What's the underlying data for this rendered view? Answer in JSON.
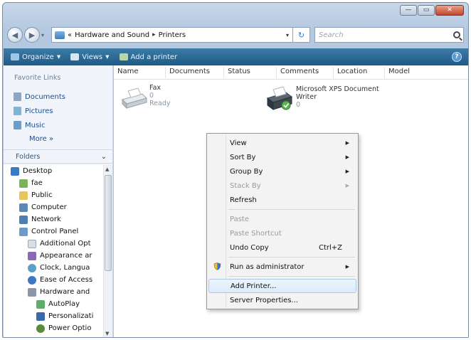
{
  "window": {
    "controls": {
      "minimize": "—",
      "maximize": "▭",
      "close": "✕"
    }
  },
  "address_bar": {
    "prefix": "«",
    "crumbs": [
      "Hardware and Sound",
      "Printers"
    ],
    "separator": "▸",
    "dropdown": "▾",
    "refresh": "↻"
  },
  "search": {
    "placeholder": "Search"
  },
  "toolbar": {
    "organize": "Organize",
    "views": "Views",
    "add_printer": "Add a printer",
    "help": "?"
  },
  "left_pane": {
    "favorite_links_title": "Favorite Links",
    "favorites": [
      "Documents",
      "Pictures",
      "Music"
    ],
    "more": "More",
    "more_arrow": "»",
    "folders_title": "Folders",
    "folders_chevron": "⌄",
    "tree": [
      "Desktop",
      "fae",
      "Public",
      "Computer",
      "Network",
      "Control Panel",
      "Additional Opt",
      "Appearance ar",
      "Clock, Langua",
      "Ease of Access",
      "Hardware and",
      "AutoPlay",
      "Personalizati",
      "Power Optio"
    ]
  },
  "columns": [
    "Name",
    "Documents",
    "Status",
    "Comments",
    "Location",
    "Model"
  ],
  "printers": [
    {
      "name": "Fax",
      "documents": "0",
      "status": "Ready"
    },
    {
      "name_line1": "Microsoft XPS Document",
      "name_line2": "Writer",
      "documents": "0"
    }
  ],
  "context_menu": {
    "items": [
      {
        "label": "View",
        "submenu": true
      },
      {
        "label": "Sort By",
        "submenu": true
      },
      {
        "label": "Group By",
        "submenu": true
      },
      {
        "label": "Stack By",
        "submenu": true,
        "disabled": true
      },
      {
        "label": "Refresh"
      },
      {
        "label": "Paste",
        "disabled": true
      },
      {
        "label": "Paste Shortcut",
        "disabled": true
      },
      {
        "label": "Undo Copy",
        "shortcut": "Ctrl+Z"
      },
      {
        "label": "Run as administrator",
        "submenu": true
      },
      {
        "label": "Add Printer...",
        "highlighted": true
      },
      {
        "label": "Server Properties..."
      }
    ],
    "submenu_arrow": "▶"
  },
  "colors": {
    "toolbar": "#2a6a96",
    "link": "#1a4e8c",
    "menu_highlight": "#dcebfb"
  }
}
